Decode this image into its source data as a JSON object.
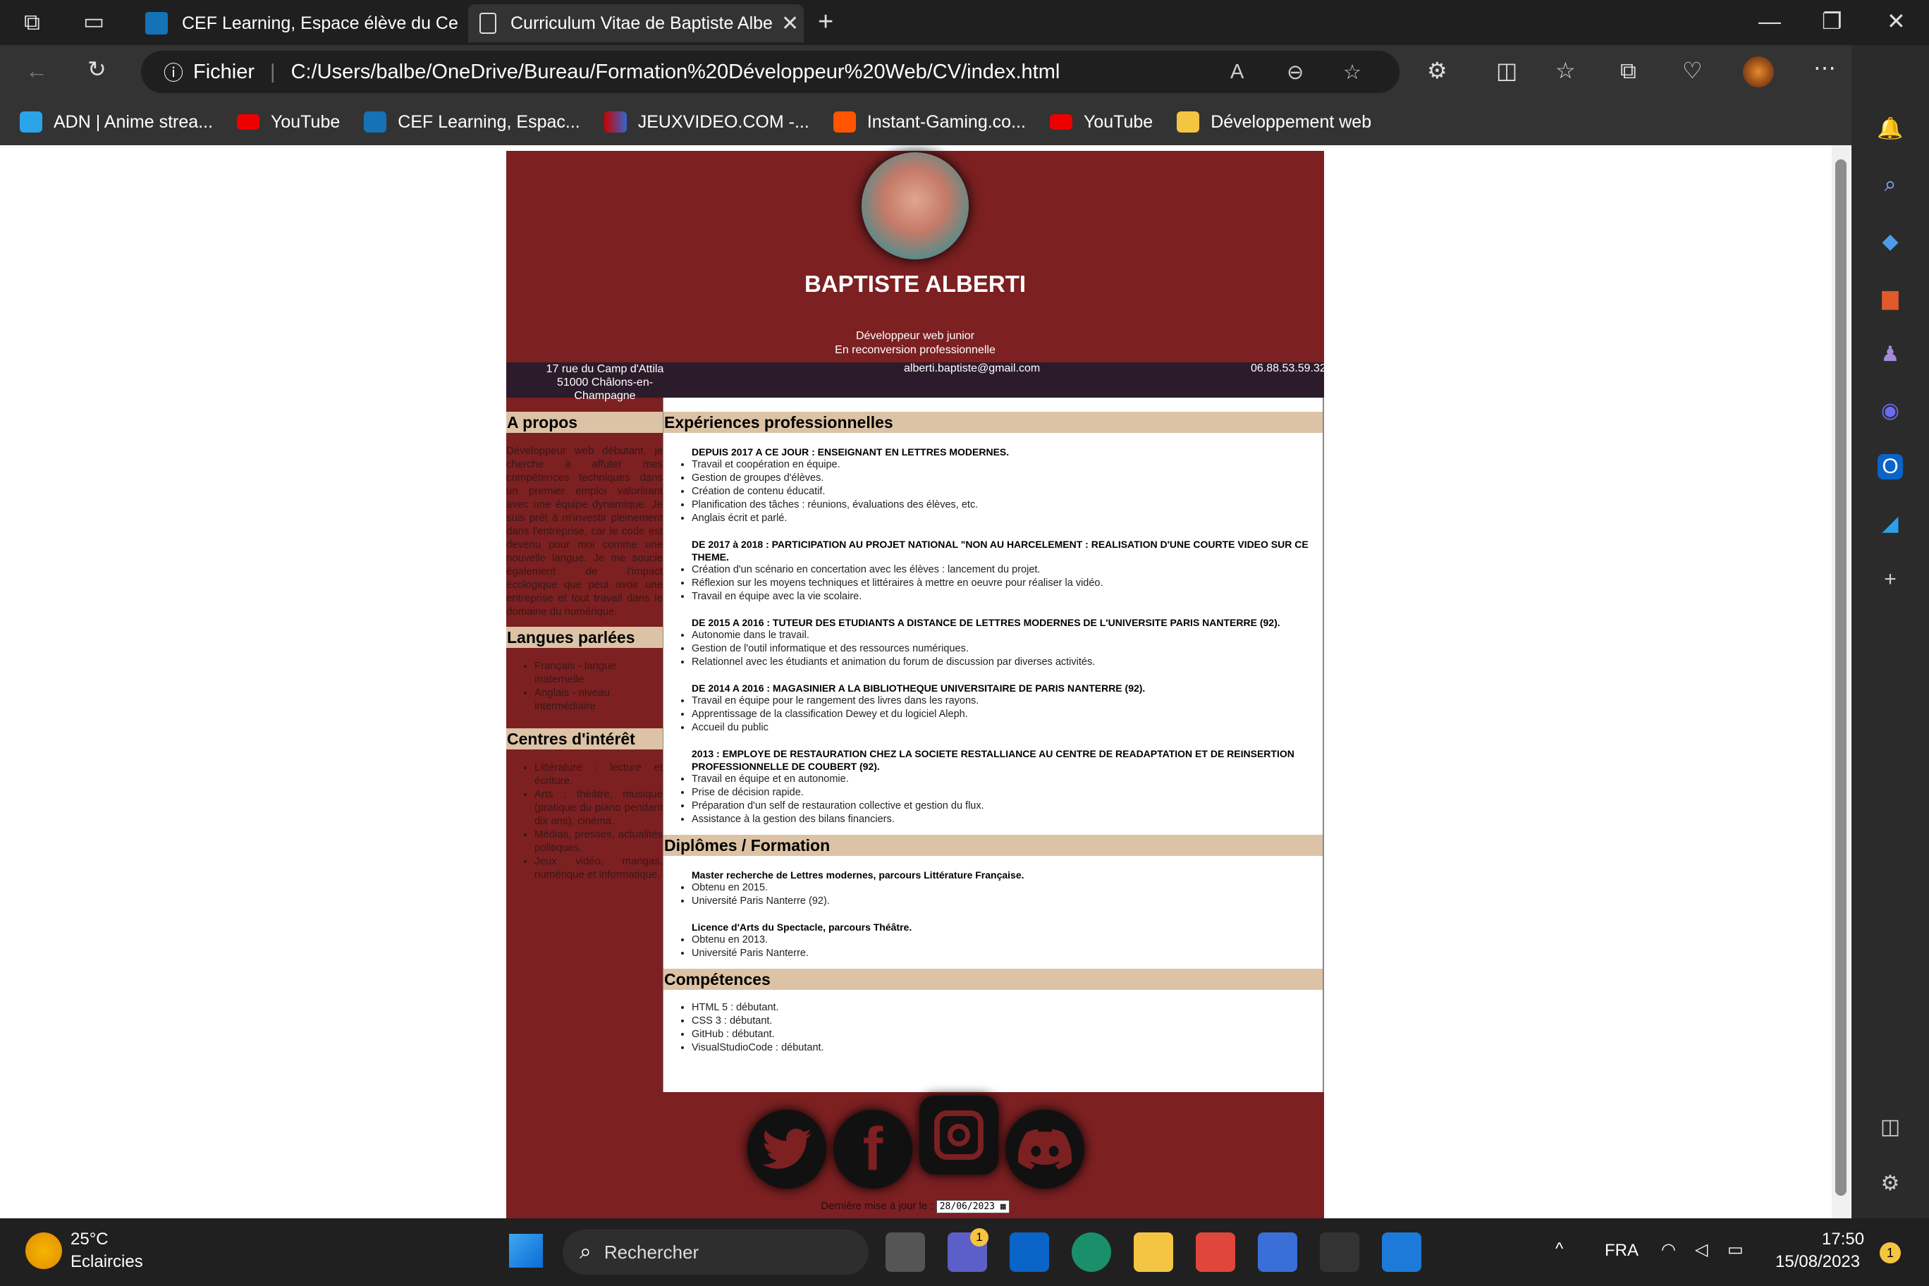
{
  "browser": {
    "tabs": [
      {
        "title": "CEF Learning, Espace élève du Ce"
      },
      {
        "title": "Curriculum Vitae de Baptiste Albe"
      }
    ],
    "address_label": "Fichier",
    "url": "C:/Users/balbe/OneDrive/Bureau/Formation%20Développeur%20Web/CV/index.html",
    "bookmarks": [
      "ADN | Anime strea...",
      "YouTube",
      "CEF Learning, Espac...",
      "JEUXVIDEO.COM -...",
      "Instant-Gaming.co...",
      "YouTube",
      "Développement web"
    ]
  },
  "cv": {
    "name": "BAPTISTE ALBERTI",
    "subtitle1": "Développeur web junior",
    "subtitle2": "En reconversion professionnelle",
    "address1": "17 rue du Camp d'Attila",
    "address2": "51000 Châlons-en-Champagne",
    "email": "alberti.baptiste@gmail.com",
    "phone": "06.88.53.59.32",
    "about_title": "A propos",
    "about_text": "Développeur web débutant, je cherche à affuter mes compétences techniques dans un premier emploi valorisant avec une équipe dynamique. Je suis prêt à m'investir pleinement dans l'entreprise, car le code est devenu pour moi comme une nouvelle langue. Je me soucie également de l'impact écologique que peut avoir une entreprise et tout travail dans le domaine du numérique.",
    "lang_title": "Langues parlées",
    "langs": [
      "Français - langue maternelle",
      "Anglais - niveau intermédiaire"
    ],
    "interest_title": "Centres d'intérêt",
    "interests": [
      "Littérature : lecture et écriture.",
      "Arts : théâtre, musique (pratique du piano pendant dix ans), cinéma.",
      "Médias, presses, actualités politiques.",
      "Jeux vidéo, mangas, numérique et informatique."
    ],
    "exp_title": "Expériences professionnelles",
    "experiences": [
      {
        "title": "DEPUIS 2017 A CE JOUR : ENSEIGNANT EN LETTRES MODERNES.",
        "items": [
          "Travail et coopération en équipe.",
          "Gestion de groupes d'élèves.",
          "Création de contenu éducatif.",
          "Planification des tâches : réunions, évaluations des élèves, etc.",
          "Anglais écrit et parlé."
        ]
      },
      {
        "title": "DE 2017 à 2018 : PARTICIPATION AU PROJET NATIONAL \"NON AU HARCELEMENT : REALISATION D'UNE COURTE VIDEO SUR CE THEME.",
        "items": [
          "Création d'un scénario en concertation avec les élèves : lancement du projet.",
          "Réflexion sur les moyens techniques et littéraires à mettre en oeuvre pour réaliser la vidéo.",
          "Travail en équipe avec la vie scolaire."
        ]
      },
      {
        "title": "DE 2015 A 2016 : TUTEUR DES ETUDIANTS A DISTANCE DE LETTRES MODERNES DE L'UNIVERSITE PARIS NANTERRE (92).",
        "items": [
          "Autonomie dans le travail.",
          "Gestion de l'outil informatique et des ressources numériques.",
          "Relationnel avec les étudiants et animation du forum de discussion par diverses activités."
        ]
      },
      {
        "title": "DE 2014 A 2016 : MAGASINIER A LA BIBLIOTHEQUE UNIVERSITAIRE DE PARIS NANTERRE (92).",
        "items": [
          "Travail en équipe pour le rangement des livres dans les rayons.",
          "Apprentissage de la classification Dewey et du logiciel Aleph.",
          "Accueil du public"
        ]
      },
      {
        "title": "2013 : EMPLOYE DE RESTAURATION CHEZ LA SOCIETE RESTALLIANCE AU CENTRE DE READAPTATION ET DE REINSERTION PROFESSIONNELLE DE COUBERT (92).",
        "items": [
          "Travail en équipe et en autonomie.",
          "Prise de décision rapide.",
          "Préparation d'un self de restauration collective et gestion du flux.",
          "Assistance à la gestion des bilans financiers."
        ]
      }
    ],
    "dip_title": "Diplômes / Formation",
    "diplomas": [
      {
        "title": "Master recherche de Lettres modernes, parcours Littérature Française.",
        "items": [
          "Obtenu en 2015.",
          "Université Paris Nanterre (92)."
        ]
      },
      {
        "title": "Licence d'Arts du Spectacle, parcours Théâtre.",
        "items": [
          "Obtenu en 2013.",
          "Université Paris Nanterre."
        ]
      }
    ],
    "skills_title": "Compétences",
    "skills": [
      "HTML 5 : débutant.",
      "CSS 3 : débutant.",
      "GitHub : débutant.",
      "VisualStudioCode : débutant."
    ],
    "footer_label": "Dernière mise à jour le :",
    "footer_date": "28/06/2023"
  },
  "taskbar": {
    "temp": "25°C",
    "weather": "Eclaircies",
    "search": "Rechercher",
    "lang": "FRA",
    "time": "17:50",
    "date": "15/08/2023",
    "notif": "1",
    "chat_badge": "1"
  }
}
